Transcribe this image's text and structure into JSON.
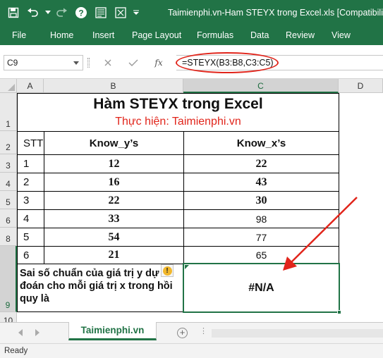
{
  "window": {
    "title": "Taimienphi.vn-Ham STEYX trong Excel.xls  [Compatibility"
  },
  "ribbon_tabs": [
    "File",
    "Home",
    "Insert",
    "Page Layout",
    "Formulas",
    "Data",
    "Review",
    "View"
  ],
  "formula_bar": {
    "name_box": "C9",
    "fx_label": "fx",
    "formula": "=STEYX(B3:B8,C3:C5)"
  },
  "columns": [
    "A",
    "B",
    "C",
    "D"
  ],
  "rows": [
    "1",
    "2",
    "3",
    "4",
    "5",
    "6",
    "8",
    "9",
    "10"
  ],
  "sheet": {
    "title": "Hàm STEYX trong Excel",
    "subtitle": "Thực hiện: Taimienphi.vn",
    "headers": [
      "STT",
      "Know_y’s",
      "Know_x’s"
    ],
    "data_rows": [
      {
        "stt": "1",
        "y": "12",
        "x": "22"
      },
      {
        "stt": "2",
        "y": "16",
        "x": "43"
      },
      {
        "stt": "3",
        "y": "22",
        "x": "30"
      },
      {
        "stt": "4",
        "y": "33",
        "x": "98"
      },
      {
        "stt": "5",
        "y": "54",
        "x": "77"
      },
      {
        "stt": "6",
        "y": "21",
        "x": "65"
      }
    ],
    "label": "Sai số chuẩn của giá trị y dự đoán cho mỗi giá trị x trong hồi quy là",
    "result": "#N/A"
  },
  "sheet_tabs": {
    "active": "Taimienphi.vn",
    "add": "+",
    "more": "⋮"
  },
  "status": {
    "text": "Ready"
  },
  "colors": {
    "excel_green": "#217346",
    "annotation_red": "#e1251b"
  }
}
